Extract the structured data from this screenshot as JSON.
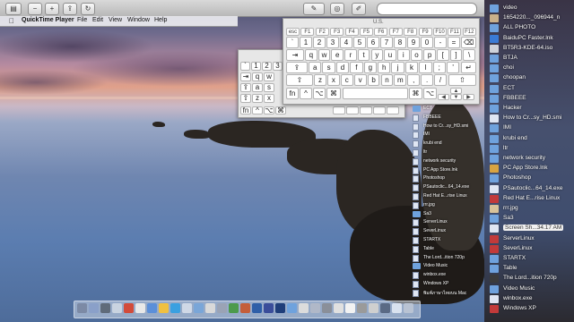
{
  "menubar": {
    "app": "QuickTime Player",
    "items": [
      "File",
      "Edit",
      "View",
      "Window",
      "Help"
    ]
  },
  "kbd_large": {
    "title": "U.S.",
    "fn_row": [
      "esc",
      "F1",
      "F2",
      "F3",
      "F4",
      "F5",
      "F6",
      "F7",
      "F8",
      "F9",
      "F10",
      "F11",
      "F12"
    ],
    "row1": [
      "`",
      "1",
      "2",
      "3",
      "4",
      "5",
      "6",
      "7",
      "8",
      "9",
      "0",
      "-",
      "="
    ],
    "row2": [
      "q",
      "w",
      "e",
      "r",
      "t",
      "y",
      "u",
      "i",
      "o",
      "p",
      "[",
      "]",
      "\\"
    ],
    "row3": [
      "a",
      "s",
      "d",
      "f",
      "g",
      "h",
      "j",
      "k",
      "l",
      ";",
      "'"
    ],
    "row4": [
      "z",
      "x",
      "c",
      "v",
      "b",
      "n",
      "m",
      ",",
      ".",
      "/"
    ],
    "mod": [
      "fn",
      "^",
      "⌥",
      "⌘",
      "⌘",
      "⌥"
    ],
    "arrows": [
      "◀",
      "▲",
      "▼",
      "▶"
    ],
    "tab": "⇥",
    "caps": "⇪",
    "shift": "⇧",
    "enter": "↵",
    "backspace": "⌫"
  },
  "kbd_small": {
    "row1": [
      "`",
      "1",
      "2",
      "3"
    ],
    "row2": [
      "⇥",
      "q",
      "w"
    ],
    "row3": [
      "⇪",
      "a",
      "s"
    ],
    "row4": [
      "⇧",
      "z",
      "x"
    ],
    "mod": [
      "fn",
      "^",
      "⌥",
      "⌘"
    ]
  },
  "middle_files": [
    {
      "label": "ECT",
      "kind": "folder"
    },
    {
      "label": "FBBEEE",
      "kind": "file"
    },
    {
      "label": "How to Cr...sy_HD.smi",
      "kind": "file"
    },
    {
      "label": "IMI",
      "kind": "file"
    },
    {
      "label": "krubi end",
      "kind": "file"
    },
    {
      "label": "ltr",
      "kind": "file"
    },
    {
      "label": "network security",
      "kind": "file"
    },
    {
      "label": "PC App Store.lnk",
      "kind": "file"
    },
    {
      "label": "Photoshop",
      "kind": "file"
    },
    {
      "label": "PSautoclic...64_14.exe",
      "kind": "file"
    },
    {
      "label": "Red Hat E...rise Linux",
      "kind": "file"
    },
    {
      "label": "rrr.jpg",
      "kind": "file"
    },
    {
      "label": "Sa3",
      "kind": "folder"
    },
    {
      "label": "ServerLinux",
      "kind": "file"
    },
    {
      "label": "SeverLinux",
      "kind": "file"
    },
    {
      "label": "STARTX",
      "kind": "file"
    },
    {
      "label": "Table",
      "kind": "file"
    },
    {
      "label": "The Lord...ition 720p",
      "kind": "file"
    },
    {
      "label": "Video Music",
      "kind": "folder"
    },
    {
      "label": "winbox.exe",
      "kind": "file"
    },
    {
      "label": "Windows XP",
      "kind": "file"
    },
    {
      "label": "พิมพ์ภาษาไทยบน Mac",
      "kind": "file"
    }
  ],
  "right_files": [
    {
      "label": "video",
      "color": "#6fa2dd"
    },
    {
      "label": "1654220..._096944_n",
      "color": "#c9b08a"
    },
    {
      "label": "ALL PHOTO",
      "color": "#6fa2dd"
    },
    {
      "label": "BaiduPC Faster.lnk",
      "color": "#3a7bd5"
    },
    {
      "label": "BT5R3-KDE-64.iso",
      "color": "#cfd3da"
    },
    {
      "label": "BTJA",
      "color": "#6fa2dd"
    },
    {
      "label": "choi",
      "color": "#6fa2dd"
    },
    {
      "label": "choopan",
      "color": "#6fa2dd"
    },
    {
      "label": "ECT",
      "color": "#6fa2dd"
    },
    {
      "label": "FBBEEE",
      "color": "#6fa2dd"
    },
    {
      "label": "Hacker",
      "color": "#6fa2dd"
    },
    {
      "label": "How to Cr...sy_HD.smi",
      "color": "#dfe6f3"
    },
    {
      "label": "IMI",
      "color": "#6fa2dd"
    },
    {
      "label": "krubi end",
      "color": "#6fa2dd"
    },
    {
      "label": "ltr",
      "color": "#6fa2dd"
    },
    {
      "label": "network security",
      "color": "#6fa2dd"
    },
    {
      "label": "PC App Store.lnk",
      "color": "#d9a441"
    },
    {
      "label": "Photoshop",
      "color": "#6fa2dd"
    },
    {
      "label": "PSautoclic...64_14.exe",
      "color": "#dfe6f3"
    },
    {
      "label": "Red Hat E...rise Linux",
      "color": "#c23a3a"
    },
    {
      "label": "rrr.jpg",
      "color": "#d8c39a"
    },
    {
      "label": "Sa3",
      "color": "#6fa2dd"
    },
    {
      "label": "Screen Sh...34.17 AM",
      "color": "#dfe6f3",
      "selected": true
    },
    {
      "label": "ServerLinux",
      "color": "#c23a3a"
    },
    {
      "label": "SeverLinux",
      "color": "#c23a3a"
    },
    {
      "label": "STARTX",
      "color": "#6fa2dd"
    },
    {
      "label": "Table",
      "color": "#6fa2dd"
    },
    {
      "label": "The Lord...ition 720p",
      "color": "#3b3b3b"
    },
    {
      "label": "Video Music",
      "color": "#6fa2dd"
    },
    {
      "label": "winbox.exe",
      "color": "#dfe6f3"
    },
    {
      "label": "Windows XP",
      "color": "#c23a3a"
    }
  ],
  "dock_icons": [
    "#7c8aa5",
    "#8aa0c9",
    "#5f6b7a",
    "#c9d3e0",
    "#d24b3a",
    "#e8e8e8",
    "#5b8fd9",
    "#f0c040",
    "#3aa0e0",
    "#cfd8e6",
    "#7aa6d8",
    "#d9d9d9",
    "#9aa3b5",
    "#4c9a4c",
    "#c45e3a",
    "#2f5fa8",
    "#3a4d9a",
    "#1f3e7a",
    "#6fa2dd",
    "#dcdcdc",
    "#b0b8c8",
    "#8a8f99",
    "#e0e0e0",
    "#f2f2f2",
    "#9a9a9a",
    "#cfcfcf",
    "#5a6a85",
    "#d9e2ef",
    "#b9c3d3"
  ]
}
